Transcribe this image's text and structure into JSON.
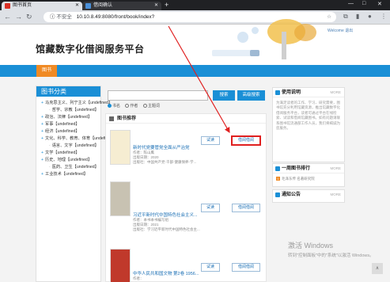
{
  "browser": {
    "tabs": [
      {
        "label": "图书首页",
        "active": true
      },
      {
        "label": "借阅确认",
        "active": false
      }
    ],
    "new_tab": "+",
    "address": {
      "security": "不安全",
      "url": "10.10.8.49:8080/front/book/index?"
    },
    "window_controls": [
      "—",
      "□",
      "✕"
    ]
  },
  "site": {
    "title": "馆藏数字化借阅服务平台",
    "welcome": "Welcome 退出",
    "nav_home": "图书"
  },
  "categories": {
    "title": "图书分类",
    "items": [
      {
        "label": "马克思主义、列宁主义【undefined】",
        "level": 0,
        "marker": "+"
      },
      {
        "label": "哲学、宗教【undefined】",
        "level": 1,
        "marker": ""
      },
      {
        "label": "政治、法律【undefined】",
        "level": 0,
        "marker": "+"
      },
      {
        "label": "军事【undefined】",
        "level": 0,
        "marker": "+"
      },
      {
        "label": "经济【undefined】",
        "level": 0,
        "marker": "+"
      },
      {
        "label": "文化、科学、教育、体育【undefined】",
        "level": 0,
        "marker": "+"
      },
      {
        "label": "语言、文字【undefined】",
        "level": 1,
        "marker": ""
      },
      {
        "label": "文学【undefined】",
        "level": 0,
        "marker": "+"
      },
      {
        "label": "历史、地理【undefined】",
        "level": 0,
        "marker": "+"
      },
      {
        "label": "医药、卫生【undefined】",
        "level": 1,
        "marker": ""
      },
      {
        "label": "工业技术【undefined】",
        "level": 0,
        "marker": "+"
      }
    ]
  },
  "search": {
    "placeholder": "",
    "search_label": "搜索",
    "advanced_label": "高级搜索",
    "filters": [
      {
        "label": "书名",
        "checked": true
      },
      {
        "label": "作者",
        "checked": false
      },
      {
        "label": "主题词",
        "checked": false
      }
    ]
  },
  "recommend": {
    "title": "图书推荐",
    "read_label": "试读",
    "borrow_label": "借阅借阅",
    "books": [
      {
        "title": "新时代党要管党全面从严治党",
        "author": "作者：陈山鹰",
        "date": "出版日期：2020",
        "publisher": "出版社：中国共产党·干部·健康保养·学...",
        "cover": "#f6edd2"
      },
      {
        "title": "习近平新时代中国特色社会主义...",
        "author": "作者：本书本书编写组",
        "date": "出版日期：2021",
        "publisher": "出版社：学习近平新时代中国特色社会主...",
        "cover": "#c8c2b2"
      },
      {
        "title": "中华人民共和国文物 第2卷 1956...",
        "author": "作者：",
        "date": "",
        "publisher": "",
        "cover": "#c0392b"
      }
    ]
  },
  "right": {
    "guide": {
      "title": "使用说明",
      "more": "MORE",
      "text": "为满足读者的工作、学习、研究需要，图书馆充分利用馆藏资源，推出馆藏数字化借阅服务平台，读者可通过平台在线检索、试读和借阅馆藏图书。如有问题请联系图书馆流通部工作人员，我们将竭诚为您服务。"
    },
    "ranking": {
      "title": "一周图书排行",
      "more": "MORE",
      "items": [
        {
          "num": "1",
          "label": "毛泽东传  名著研究院"
        },
        {
          "num": "2",
          "label": ""
        }
      ]
    },
    "notice": {
      "title": "通知公告",
      "more": "MORE"
    }
  },
  "watermark": {
    "line1": "激活 Windows",
    "line2": "转到\"控制面板\"中的\"系统\"以激活 Windows。"
  },
  "scroll_top": "∧"
}
